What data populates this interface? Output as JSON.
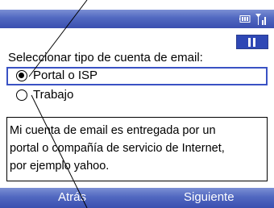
{
  "status_bar": {
    "icons": [
      "battery-icon",
      "signal-icon"
    ],
    "background_color": "#4a60bd"
  },
  "screen": {
    "prompt": "Seleccionar tipo de cuenta de email:",
    "options": [
      {
        "label": "Portal o ISP",
        "selected": true
      },
      {
        "label": "Trabajo",
        "selected": false
      }
    ],
    "description_lines": [
      "Mi cuenta de email es entregada por un",
      "portal o compañía de servicio de Internet,",
      "por ejemplo yahoo."
    ]
  },
  "softkeys": {
    "left_label": "Atrás",
    "right_label": "Siguiente"
  },
  "colors": {
    "accent": "#3a52c4",
    "softkey_text": "#ffffff"
  }
}
